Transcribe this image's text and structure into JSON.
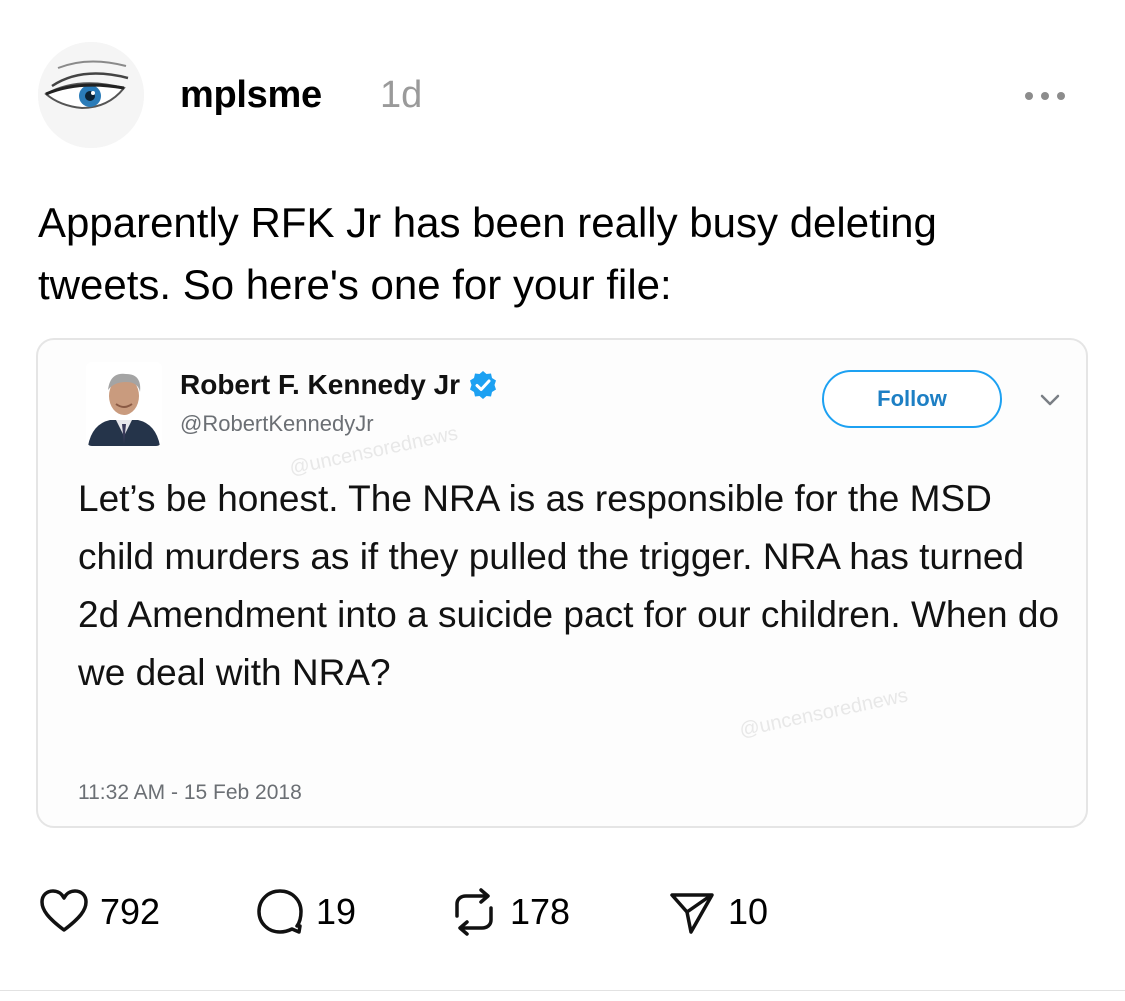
{
  "post": {
    "username": "mplsme",
    "time": "1d",
    "text": "Apparently RFK Jr has been really busy deleting tweets. So here's one for your file:",
    "more_icon": "more-horizontal-icon"
  },
  "embedded_tweet": {
    "name": "Robert F. Kennedy Jr",
    "handle": "@RobertKennedyJr",
    "verified": true,
    "follow_label": "Follow",
    "text": "Let’s be honest. The NRA is as responsible for the MSD child murders as if they pulled the trigger. NRA has turned 2d Amendment into a suicide pact for our children. When do we deal with NRA?",
    "timestamp": "11:32 AM - 15 Feb 2018"
  },
  "actions": {
    "likes": "792",
    "replies": "19",
    "reposts": "178",
    "shares": "10"
  },
  "colors": {
    "accent": "#1da1f2",
    "muted": "#9a9a9a"
  }
}
